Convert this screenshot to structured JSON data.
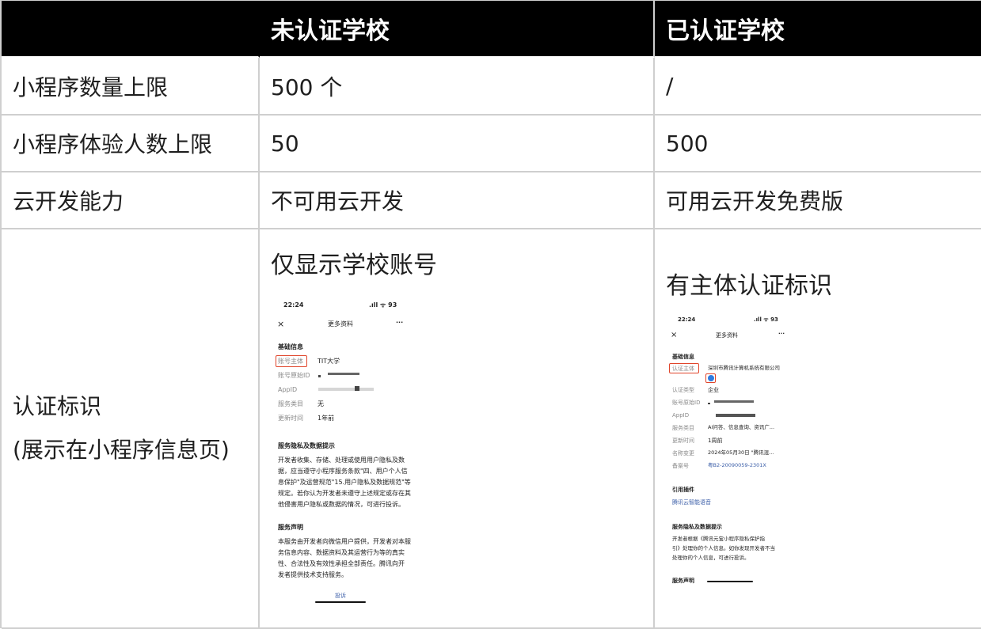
{
  "header": {
    "col_blank": "",
    "col_unverified": "未认证学校",
    "col_verified": "已认证学校"
  },
  "rows": [
    {
      "label": "小程序数量上限",
      "unverified": "500 个",
      "verified": "/"
    },
    {
      "label": "小程序体验人数上限",
      "unverified": "50",
      "verified": "500"
    },
    {
      "label": "云开发能力",
      "unverified": "不可用云开发",
      "verified": "可用云开发免费版"
    }
  ],
  "identity_row": {
    "label_line1": "认证标识",
    "label_line2": "(展示在小程序信息页)",
    "unverified_caption": "仅显示学校账号",
    "verified_caption": "有主体认证标识"
  },
  "phone_left": {
    "time": "22:24",
    "status": ".ıll ᯤ 93",
    "close": "×",
    "title": "更多资料",
    "more": "···",
    "section_basic": "基础信息",
    "fields": [
      {
        "k": "账号主体",
        "v": "TIT大学"
      },
      {
        "k": "账号原始ID",
        "v": ""
      },
      {
        "k": "AppID",
        "v": ""
      },
      {
        "k": "服务类目",
        "v": "无"
      },
      {
        "k": "更新时间",
        "v": "1年前"
      }
    ],
    "section_privacy": "服务隐私及数据提示",
    "privacy_lines": [
      "开发者收集、存储、处理或使用用户隐私及数",
      "据，应当遵守小程序服务条款\"四、用户个人信",
      "息保护\"及运营规范\"15.用户隐私及数据规范\"等",
      "规定。若你认为开发者未遵守上述规定或存在其",
      "他侵害用户隐私或数据的情况，可进行投诉。"
    ],
    "section_statement": "服务声明",
    "statement_lines": [
      "本服务由开发者向微信用户提供，开发者对本服",
      "务信息内容、数据资料及其运营行为等的真实",
      "性、合法性及有效性承担全部责任。腾讯向开",
      "发者提供技术支持服务。"
    ],
    "complaint": "投诉"
  },
  "phone_right": {
    "time": "22:24",
    "status": ".ıll ᯤ 93",
    "close": "×",
    "title": "更多资料",
    "more": "···",
    "section_basic": "基础信息",
    "fields": [
      {
        "k": "认证主体",
        "v": "深圳市腾讯计算机系统有限公司"
      },
      {
        "k": "认证类型",
        "v": "企业"
      },
      {
        "k": "账号原始ID",
        "v": ""
      },
      {
        "k": "AppID",
        "v": ""
      },
      {
        "k": "服务类目",
        "v": "AI问答、信息查询、资讯广..."
      },
      {
        "k": "更新时间",
        "v": "1周前"
      },
      {
        "k": "名称变更",
        "v": "2024年05月30日 \"腾讯混..."
      },
      {
        "k": "备案号",
        "v": "粤B2-20090059-2301X"
      }
    ],
    "section_plugin": "引用插件",
    "plugin_name": "腾讯云智能语音",
    "section_privacy": "服务隐私及数据提示",
    "privacy_lines": [
      "开发者根据《腾讯元宝小程序隐私保护指",
      "引》处理你的个人信息。如你发现开发者不当",
      "处理你的个人信息，可进行投诉。"
    ],
    "section_statement": "服务声明"
  }
}
